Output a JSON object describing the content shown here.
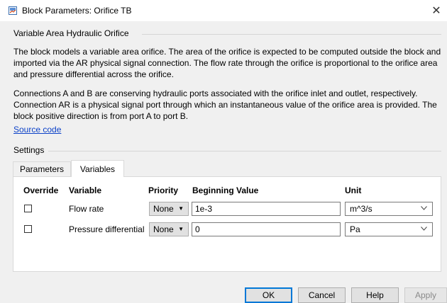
{
  "window": {
    "title": "Block Parameters: Orifice TB",
    "close_glyph": "✕"
  },
  "block": {
    "group_title": "Variable Area Hydraulic Orifice",
    "description1": "The block models a variable area orifice. The area of the orifice is expected to be computed outside the block and imported via the AR physical signal connection. The flow rate through the orifice is proportional to the orifice area and pressure differential across the orifice.",
    "description2": "Connections A and B are conserving hydraulic ports associated with the orifice inlet and outlet, respectively. Connection AR is a physical signal port through which an instantaneous value of the orifice area is provided. The block positive direction is from port A to port B.",
    "source_link": "Source code"
  },
  "settings": {
    "title": "Settings",
    "tabs": [
      {
        "label": "Parameters",
        "active": false
      },
      {
        "label": "Variables",
        "active": true
      }
    ],
    "columns": {
      "override": "Override",
      "variable": "Variable",
      "priority": "Priority",
      "beginning_value": "Beginning Value",
      "unit": "Unit"
    },
    "rows": [
      {
        "override": false,
        "variable": "Flow rate",
        "priority": "None",
        "value": "1e-3",
        "unit": "m^3/s"
      },
      {
        "override": false,
        "variable": "Pressure differential",
        "priority": "None",
        "value": "0",
        "unit": "Pa"
      }
    ]
  },
  "buttons": {
    "ok": "OK",
    "cancel": "Cancel",
    "help": "Help",
    "apply": "Apply"
  },
  "icons": {
    "title": "simulink-block-icon",
    "close": "close-icon",
    "dropdown": "triangle-down-icon",
    "unit_dropdown": "chevron-down-icon"
  }
}
